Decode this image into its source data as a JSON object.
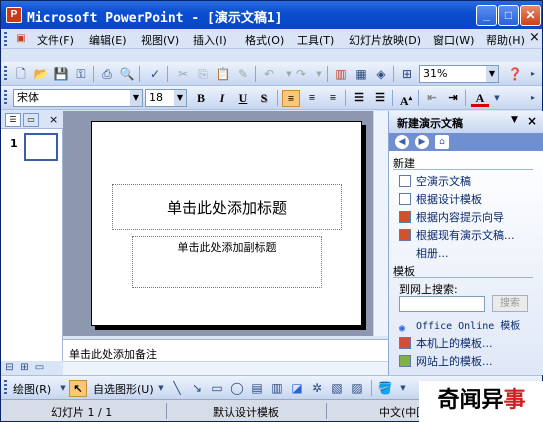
{
  "window": {
    "title": "Microsoft PowerPoint - [演示文稿1]",
    "controls": {
      "minimize": "_",
      "maximize": "□",
      "close": "✕"
    },
    "doc_close": "×"
  },
  "menu": [
    "文件(F)",
    "编辑(E)",
    "视图(V)",
    "插入(I)",
    "格式(O)",
    "工具(T)",
    "幻灯片放映(D)",
    "窗口(W)",
    "帮助(H)"
  ],
  "toolbar": {
    "zoom": "31%"
  },
  "format": {
    "font": "宋体",
    "size": "18",
    "bold": "B",
    "italic": "I",
    "underline": "U",
    "shadow": "S"
  },
  "left_pane": {
    "slide_number": "1",
    "close": "×"
  },
  "slide": {
    "title_placeholder": "单击此处添加标题",
    "subtitle_placeholder": "单击此处添加副标题"
  },
  "notes": {
    "placeholder": "单击此处添加备注"
  },
  "task_pane": {
    "title": "新建演示文稿",
    "section_new": "新建",
    "new_items": [
      "空演示文稿",
      "根据设计模板",
      "根据内容提示向导",
      "根据现有演示文稿..."
    ],
    "photo_album": "相册...",
    "section_templates": "模板",
    "search_label": "到网上搜索:",
    "search_button": "搜索",
    "template_items": [
      "Office Online 模板",
      "本机上的模板...",
      "网站上的模板..."
    ]
  },
  "drawing": {
    "draw_label": "绘图(R)",
    "autoshapes_label": "自选图形(U)"
  },
  "status": {
    "slide": "幻灯片 1 / 1",
    "design": "默认设计模板",
    "language": "中文(中国)"
  },
  "watermark": {
    "text_black": "奇闻异",
    "text_red": "事"
  },
  "colors": {
    "titlebar": "#0b4fd0",
    "chrome": "#d9e5f7",
    "slide_bg": "#8d98b0",
    "watermark_red": "#d21e1e"
  }
}
